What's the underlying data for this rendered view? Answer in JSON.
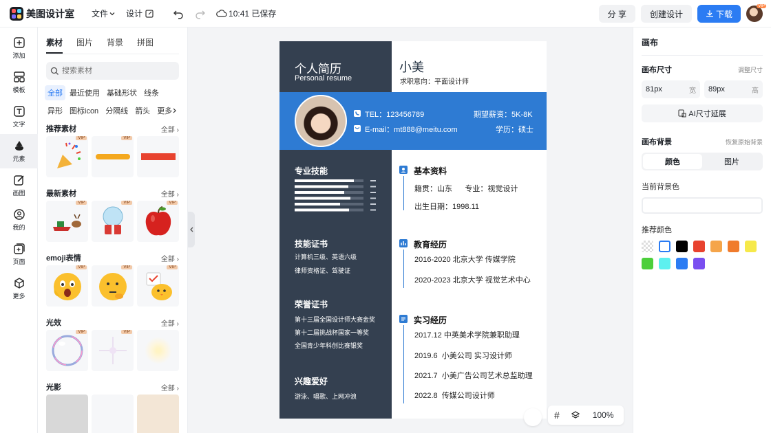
{
  "app": {
    "title": "美图设计室"
  },
  "menu": {
    "file": "文件",
    "design": "设计"
  },
  "status": {
    "saved": "10:41 已保存"
  },
  "topbar": {
    "share": "分 享",
    "create": "创建设计",
    "download": "下载",
    "vip": "VIP"
  },
  "rail": [
    {
      "label": "添加",
      "icon": "plus-square-icon"
    },
    {
      "label": "模板",
      "icon": "template-icon"
    },
    {
      "label": "文字",
      "icon": "text-icon"
    },
    {
      "label": "元素",
      "icon": "shapes-icon"
    },
    {
      "label": "画图",
      "icon": "draw-icon"
    },
    {
      "label": "我的",
      "icon": "user-icon"
    },
    {
      "label": "页面",
      "icon": "page-add-icon"
    },
    {
      "label": "更多",
      "icon": "cube-icon"
    }
  ],
  "panel": {
    "tabs": [
      "素材",
      "图片",
      "背景",
      "拼图"
    ],
    "search_placeholder": "搜索素材",
    "chips": [
      "全部",
      "最近使用",
      "基础形状",
      "线条",
      "异形",
      "图标icon",
      "分隔线",
      "箭头",
      "更多"
    ],
    "sections": [
      {
        "title": "推荐素材",
        "all": "全部"
      },
      {
        "title": "最新素材",
        "all": "全部"
      },
      {
        "title": "emoji表情",
        "all": "全部"
      },
      {
        "title": "光效",
        "all": "全部"
      },
      {
        "title": "光影",
        "all": "全部"
      }
    ],
    "vip": "VIP"
  },
  "resume": {
    "heading": "个人简历",
    "heading_en": "Personal resume",
    "name": "小美",
    "intent": "求职意向：平面设计师",
    "tel": "TEL：123456789",
    "email": "E-mail：mt888@meitu.com",
    "salary": "期望薪资：5K-8K",
    "degree": "学历：硕士",
    "skills_title": "专业技能",
    "skill_values": [
      0.86,
      0.78,
      0.72,
      0.81,
      0.66,
      0.79
    ],
    "cert_title": "技能证书",
    "certs": [
      "计算机三级、英语六级",
      "律师资格证、驾驶证"
    ],
    "honor_title": "荣誉证书",
    "honors": [
      "第十三届全国设计师大赛金奖",
      "第十二届挑战杯国家一等奖",
      "全国青少年科创比赛银奖"
    ],
    "hobby_title": "兴趣爱好",
    "hobbies": "游泳、唱歌、上网冲浪",
    "basic_title": "基本资料",
    "basic": [
      "籍贯：山东      专业：视觉设计",
      "出生日期：1998.11"
    ],
    "edu_title": "教育经历",
    "edu": [
      "2016-2020 北京大学 传媒学院",
      "2020-2023 北京大学 视觉艺术中心"
    ],
    "intern_title": "实习经历",
    "intern": [
      "2017.12 中英美术学院兼职助理",
      "2019.6  小美公司 实习设计师",
      "2021.7  小美广告公司艺术总监助理",
      "2022.8  传媒公司设计师"
    ]
  },
  "rightpanel": {
    "title": "画布",
    "size_label": "画布尺寸",
    "size_adjust": "调整尺寸",
    "width_value": "81px",
    "width_unit": "宽",
    "height_value": "89px",
    "height_unit": "高",
    "ai_extend": "AI尺寸延展",
    "bg_label": "画布背景",
    "bg_reset": "恢复原始背景",
    "seg_color": "颜色",
    "seg_image": "图片",
    "current_bg": "当前背景色",
    "recommend": "推荐颜色",
    "swatches": [
      "transparent",
      "#ffffff",
      "#000000",
      "#e8432f",
      "#f5a54a",
      "#f07b2c",
      "#f6e94a",
      "#4ccf3b",
      "#5df0ef",
      "#2b7cf3",
      "#7a4ff0"
    ]
  },
  "zoom": "100%"
}
